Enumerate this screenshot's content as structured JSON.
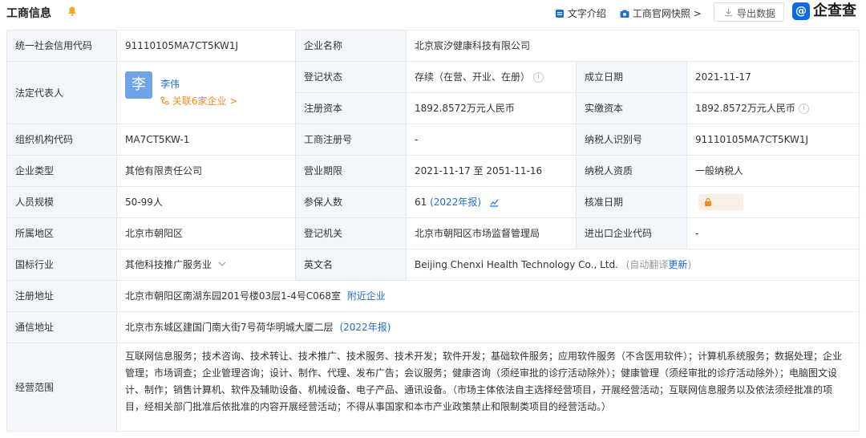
{
  "header": {
    "title": "工商信息",
    "text_intro": "文字介绍",
    "snapshot": "工商官网快照",
    "export": "导出数据",
    "logo_text": "企查查"
  },
  "colors": {
    "label_bg": "#f2f6fb",
    "link": "#1f6fd1",
    "brand": "#0a6ce0",
    "accent": "#f08c21"
  },
  "fields": {
    "credit_code": {
      "label": "统一社会信用代码",
      "value": "91110105MA7CT5KW1J"
    },
    "company_name": {
      "label": "企业名称",
      "value": "北京宸汐健康科技有限公司"
    },
    "legal_rep": {
      "label": "法定代表人",
      "avatar_char": "李",
      "name": "李伟",
      "related": "关联6家企业 >"
    },
    "reg_status": {
      "label": "登记状态",
      "value": "存续（在营、开业、在册）"
    },
    "found_date": {
      "label": "成立日期",
      "value": "2021-11-17"
    },
    "reg_capital": {
      "label": "注册资本",
      "value": "1892.8572万元人民币"
    },
    "paid_capital": {
      "label": "实缴资本",
      "value": "1892.8572万元人民币"
    },
    "org_code": {
      "label": "组织机构代码",
      "value": "MA7CT5KW-1"
    },
    "biz_reg_no": {
      "label": "工商注册号",
      "value": "-"
    },
    "taxpayer_id": {
      "label": "纳税人识别号",
      "value": "91110105MA7CT5KW1J"
    },
    "company_type": {
      "label": "企业类型",
      "value": "其他有限责任公司"
    },
    "biz_term": {
      "label": "营业期限",
      "value": "2021-11-17 至 2051-11-16"
    },
    "taxpayer_qual": {
      "label": "纳税人资质",
      "value": "一般纳税人"
    },
    "staff_size": {
      "label": "人员规模",
      "value": "50-99人"
    },
    "insured": {
      "label": "参保人数",
      "value": "61",
      "note": "(2022年报)"
    },
    "approve_date": {
      "label": "核准日期"
    },
    "region": {
      "label": "所属地区",
      "value": "北京市朝阳区"
    },
    "authority": {
      "label": "登记机关",
      "value": "北京市朝阳区市场监督管理局"
    },
    "import_export": {
      "label": "进出口企业代码",
      "value": "-"
    },
    "industry": {
      "label": "国标行业",
      "value": "其他科技推广服务业"
    },
    "english_name": {
      "label": "英文名",
      "value": "Beijing Chenxi Health Technology Co., Ltd.",
      "note": "(自动翻译",
      "update": "更新",
      "close": ")"
    },
    "reg_address": {
      "label": "注册地址",
      "value": "北京市朝阳区南湖东园201号楼03层1-4号C068室",
      "link": "附近企业"
    },
    "mail_address": {
      "label": "通信地址",
      "value": "北京市东城区建国门南大街7号荷华明城大厦二层",
      "note": "(2022年报)"
    },
    "scope": {
      "label": "经营范围",
      "value": "互联网信息服务；技术咨询、技术转让、技术推广、技术服务、技术开发；软件开发；基础软件服务；应用软件服务（不含医用软件）；计算机系统服务；数据处理；企业管理；市场调查；企业管理咨询；设计、制作、代理、发布广告；会议服务；健康咨询（须经审批的诊疗活动除外）；健康管理（须经审批的诊疗活动除外）；电脑图文设计、制作；销售计算机、软件及辅助设备、机械设备、电子产品、通讯设备。（市场主体依法自主选择经营项目，开展经营活动；互联网信息服务以及依法须经批准的项目，经相关部门批准后依批准的内容开展经营活动；不得从事国家和本市产业政策禁止和限制类项目的经营活动。）"
    }
  }
}
